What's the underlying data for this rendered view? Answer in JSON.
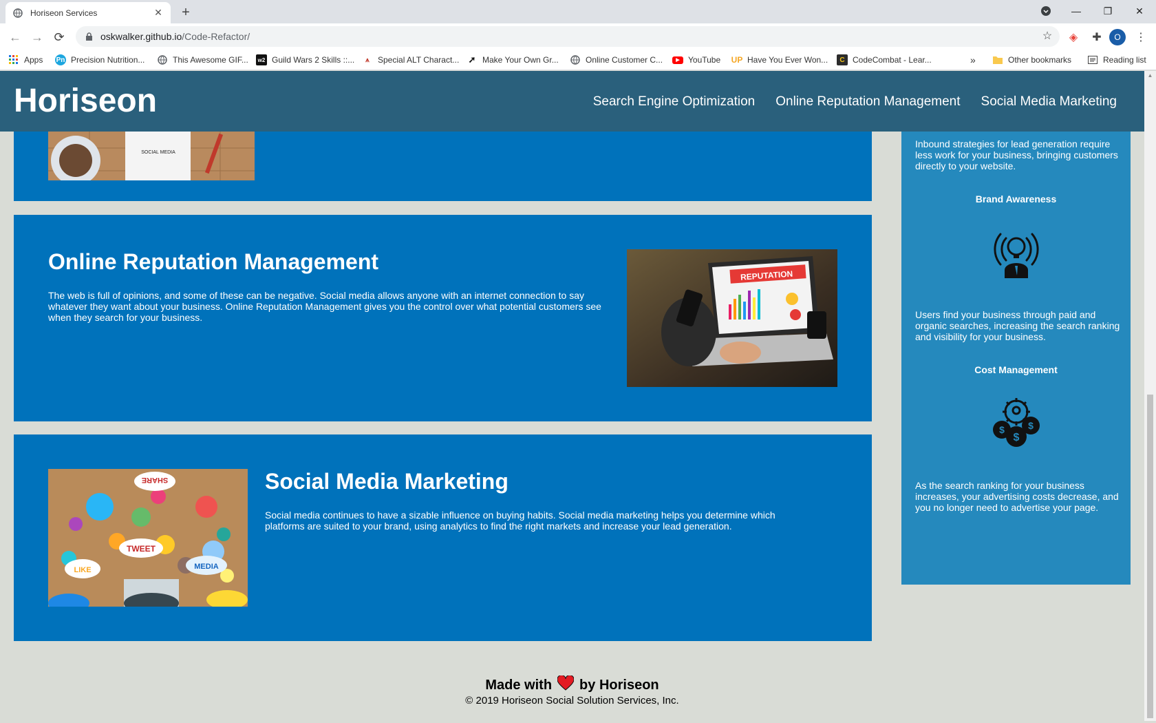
{
  "browser": {
    "tab_title": "Horiseon Services",
    "url_host": "oskwalker.github.io",
    "url_path": "/Code-Refactor/",
    "profile_initial": "O",
    "bookmarks": [
      {
        "label": "Apps",
        "icon": "apps-grid-icon"
      },
      {
        "label": "Precision Nutrition...",
        "icon": "pn-icon"
      },
      {
        "label": "This Awesome GIF...",
        "icon": "globe-icon"
      },
      {
        "label": "Guild Wars 2 Skills ::...",
        "icon": "gw2-icon"
      },
      {
        "label": "Special ALT Charact...",
        "icon": "alt-icon"
      },
      {
        "label": "Make Your Own Gr...",
        "icon": "rocket-icon"
      },
      {
        "label": "Online Customer C...",
        "icon": "globe-icon"
      },
      {
        "label": "YouTube",
        "icon": "youtube-icon"
      },
      {
        "label": "Have You Ever Won...",
        "icon": "up-icon"
      },
      {
        "label": "CodeCombat - Lear...",
        "icon": "codecombat-icon"
      }
    ],
    "overflow_label": "»",
    "other_bookmarks": "Other bookmarks",
    "reading_list": "Reading list"
  },
  "site": {
    "logo": "Horiseon",
    "nav": [
      "Search Engine Optimization",
      "Online Reputation Management",
      "Social Media Marketing"
    ]
  },
  "cards": {
    "reputation": {
      "title": "Online Reputation Management",
      "body": "The web is full of opinions, and some of these can be negative. Social media allows anyone with an internet connection to say whatever they want about your business. Online Reputation Management gives you the control over what potential customers see when they search for your business.",
      "image_label": "REPUTATION"
    },
    "social": {
      "title": "Social Media Marketing",
      "body": "Social media continues to have a sizable influence on buying habits. Social media marketing helps you determine which platforms are suited to your brand, using analytics to find the right markets and increase your lead generation.",
      "image_words": [
        "SHARE",
        "TWEET",
        "LIKE",
        "MEDIA"
      ]
    },
    "top_image_label": "SOCIAL MEDIA"
  },
  "sidebar": {
    "lead_text": "Inbound strategies for lead generation require less work for your business, bringing customers directly to your website.",
    "brand_title": "Brand Awareness",
    "brand_text": "Users find your business through paid and organic searches, increasing the search ranking and visibility for your business.",
    "cost_title": "Cost Management",
    "cost_text": "As the search ranking for your business increases, your advertising costs decrease, and you no longer need to advertise your page."
  },
  "footer": {
    "made_prefix": "Made with",
    "made_suffix": "by Horiseon",
    "copyright": "© 2019 Horiseon Social Solution Services, Inc."
  },
  "colors": {
    "header": "#2a607c",
    "card": "#0072bb",
    "sidebar": "#2589bd",
    "page": "#d9dcd6",
    "heart": "#e31b23"
  }
}
